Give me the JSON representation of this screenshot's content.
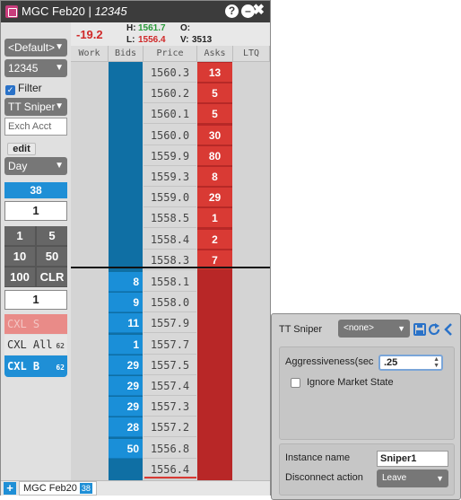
{
  "window": {
    "title": "MGC Feb20",
    "separator": "|",
    "account": "12345",
    "help_glyph": "?",
    "min_glyph": "–",
    "close_glyph": "✖"
  },
  "stats": {
    "net_change": "-19.2",
    "high_label": "H:",
    "high": "1561.7",
    "low_label": "L:",
    "low": "1556.4",
    "open_label": "O:",
    "open": "",
    "volume_label": "V:",
    "volume": "3513",
    "colors": {
      "high": "#2a9a3a",
      "low": "#d02828",
      "net_change": "#d02828"
    }
  },
  "left_panel": {
    "template_dropdown": "<Default>",
    "account_dropdown": "12345",
    "filter_label": "Filter",
    "filter_checked": true,
    "algo_dropdown": "TT Sniper",
    "exch_acct_placeholder": "Exch Acct",
    "edit_label": "edit",
    "tif_dropdown": "Day",
    "position": "38",
    "order_qty": "1",
    "qty_buttons": [
      "1",
      "5",
      "10",
      "50",
      "100",
      "CLR"
    ],
    "default_qty": "1",
    "cxl_s_label": "CXL S",
    "cxl_all_label": "CXL All",
    "cxl_all_count": "62",
    "cxl_b_label": "CXL B",
    "cxl_b_count": "62",
    "dropdown_arrow": "▼"
  },
  "ladder": {
    "columns": [
      "Work",
      "Bids",
      "Price",
      "Asks",
      "LTQ"
    ],
    "asks": [
      {
        "price": "1560.3",
        "qty": "13"
      },
      {
        "price": "1560.2",
        "qty": "5"
      },
      {
        "price": "1560.1",
        "qty": "5"
      },
      {
        "price": "1560.0",
        "qty": "30"
      },
      {
        "price": "1559.9",
        "qty": "80"
      },
      {
        "price": "1559.3",
        "qty": "8"
      },
      {
        "price": "1559.0",
        "qty": "29"
      },
      {
        "price": "1558.5",
        "qty": "1"
      },
      {
        "price": "1558.4",
        "qty": "2"
      },
      {
        "price": "1558.3",
        "qty": "7"
      }
    ],
    "bids": [
      {
        "price": "1558.1",
        "qty": "8"
      },
      {
        "price": "1558.0",
        "qty": "9"
      },
      {
        "price": "1557.9",
        "qty": "11"
      },
      {
        "price": "1557.7",
        "qty": "1"
      },
      {
        "price": "1557.5",
        "qty": "29"
      },
      {
        "price": "1557.4",
        "qty": "29"
      },
      {
        "price": "1557.3",
        "qty": "29"
      },
      {
        "price": "1557.2",
        "qty": "28"
      },
      {
        "price": "1556.8",
        "qty": "50"
      },
      {
        "price": "1556.4",
        "qty": ""
      }
    ],
    "colors": {
      "bid": "#1a8fd8",
      "ask": "#d93a34",
      "price": "#d8d8d8"
    }
  },
  "tabbar": {
    "add_glyph": "+",
    "tab_label": "MGC Feb20",
    "tab_badge": "38"
  },
  "sniper": {
    "title": "TT Sniper",
    "template_dropdown": "<none>",
    "save_icon": "save-icon",
    "refresh_icon": "refresh-icon",
    "collapse_icon": "chevron-left-icon",
    "aggressiveness_label": "Aggressiveness(sec",
    "aggressiveness_value": ".25",
    "ignore_market_state_label": "Ignore Market State",
    "ignore_market_state_checked": false,
    "instance_name_label": "Instance name",
    "instance_name_value": "Sniper1",
    "disconnect_action_label": "Disconnect action",
    "disconnect_action_value": "Leave"
  }
}
